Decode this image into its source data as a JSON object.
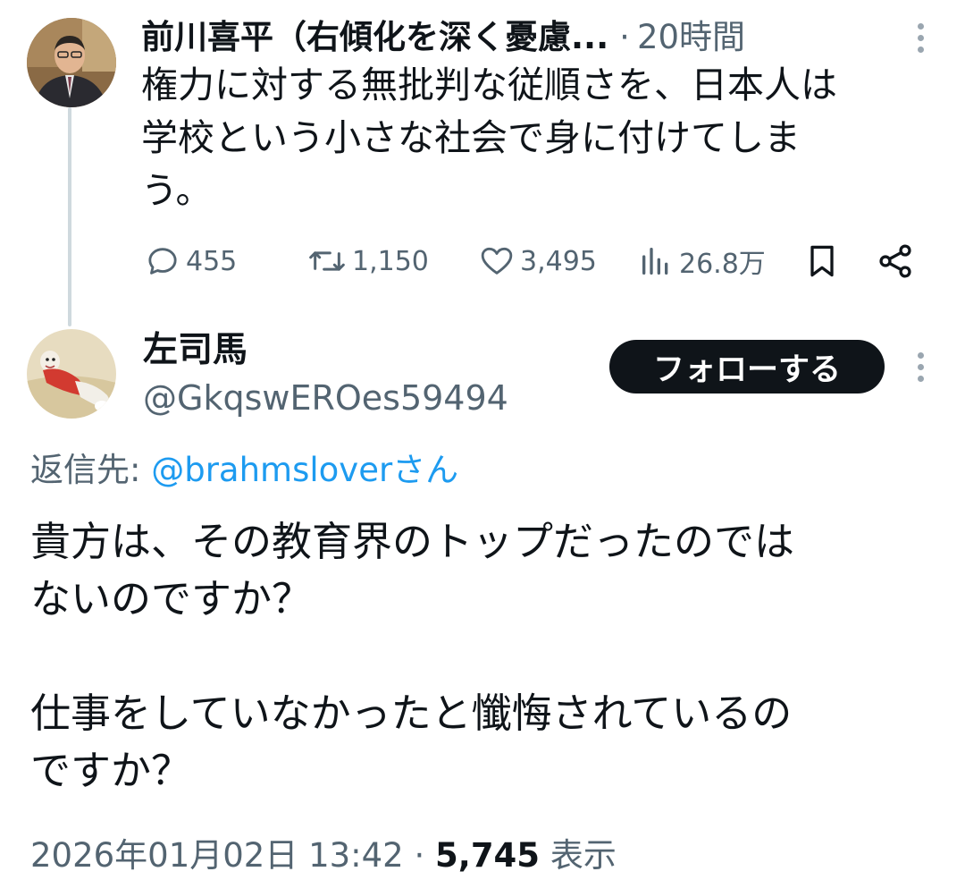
{
  "parent_tweet": {
    "author_name": "前川喜平（右傾化を深く憂慮...",
    "separator": "·",
    "time": "20時間",
    "text_lines": [
      "権力に対する無批判な従順さを、日本人は",
      "学校という小さな社会で身に付けてしま",
      "う。"
    ],
    "replies": "455",
    "retweets": "1,150",
    "likes": "3,495",
    "views": "26.8万",
    "icons": {
      "reply": "reply-icon",
      "retweet": "retweet-icon",
      "like": "heart-icon",
      "views": "views-icon",
      "bookmark": "bookmark-icon",
      "share": "share-icon",
      "more": "more-icon"
    }
  },
  "reply_tweet": {
    "author_name": "左司馬",
    "handle": "@GkqswEROes59494",
    "follow_label": "フォローする",
    "reply_to_prefix": "返信先: ",
    "reply_to_mention": "@brahmsloverさん",
    "text_paragraph_1": [
      "貴方は、その教育界のトップだったのでは",
      "ないのですか？"
    ],
    "text_paragraph_2": [
      "仕事をしていなかったと懺悔されているの",
      "ですか？"
    ],
    "timestamp": "2026年01月02日 13:42",
    "meta_separator": " · ",
    "views_count": "5,745",
    "views_label": " 表示"
  },
  "colors": {
    "primary_text": "#0f1419",
    "secondary_text": "#536471",
    "link": "#1d9bf0",
    "follow_button_bg": "#0f1419",
    "thread_line": "#cfd9de"
  }
}
